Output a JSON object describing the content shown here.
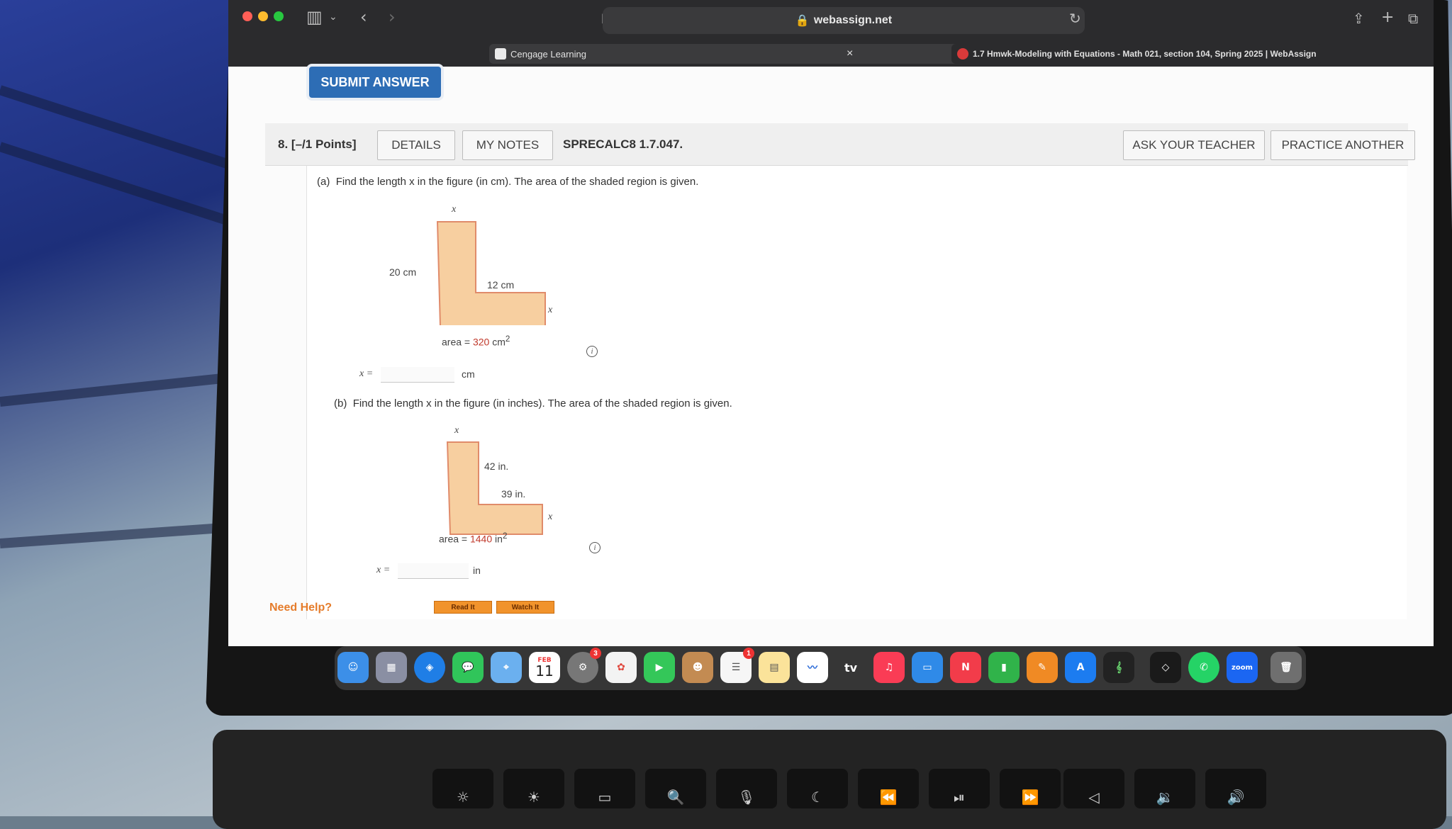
{
  "browser": {
    "url": "webassign.net",
    "tabs": [
      {
        "label": "Cengage Learning"
      },
      {
        "label": "1.7 Hmwk-Modeling with Equations - Math 021, section 104, Spring 2025 | WebAssign"
      }
    ],
    "close_glyph": "×"
  },
  "page": {
    "submit_label": "SUBMIT ANSWER",
    "question": {
      "number": "8.",
      "points": "[–/1 Points]",
      "details_label": "DETAILS",
      "notes_label": "MY NOTES",
      "code": "SPRECALC8 1.7.047.",
      "ask_label": "ASK YOUR TEACHER",
      "practice_label": "PRACTICE ANOTHER"
    },
    "part_a": {
      "tag": "(a)",
      "prompt": "Find the length x in the figure (in cm). The area of the shaded region is given.",
      "labels": {
        "top_x": "x",
        "side": "20 cm",
        "inner": "12 cm",
        "right_x": "x"
      },
      "area_text": "area = ",
      "area_value": "320",
      "area_unit": "cm",
      "area_exp": "2",
      "answer_var": "x =",
      "answer_unit": "cm"
    },
    "part_b": {
      "tag": "(b)",
      "prompt": "Find the length x in the figure (in inches). The area of the shaded region is given.",
      "labels": {
        "top_x": "x",
        "side": "42 in.",
        "inner": "39 in.",
        "right_x": "x"
      },
      "area_text": "area = ",
      "area_value": "1440",
      "area_unit": "in",
      "area_exp": "2",
      "answer_var": "x =",
      "answer_unit": "in"
    },
    "help": {
      "label": "Need Help?",
      "read": "Read It",
      "watch": "Watch It"
    },
    "info_glyph": "i"
  },
  "dock": {
    "calendar_month": "FEB",
    "calendar_day": "11",
    "tv_label": "tv",
    "zoom_label": "zoom",
    "badges": {
      "settings": "3",
      "reminders": "1"
    }
  },
  "keyboard": [
    "☼",
    "☀",
    "▭",
    "🔍",
    "🎙",
    "☾",
    "⏪",
    "⏯",
    "⏩",
    "◁",
    "🔉",
    "🔊"
  ]
}
